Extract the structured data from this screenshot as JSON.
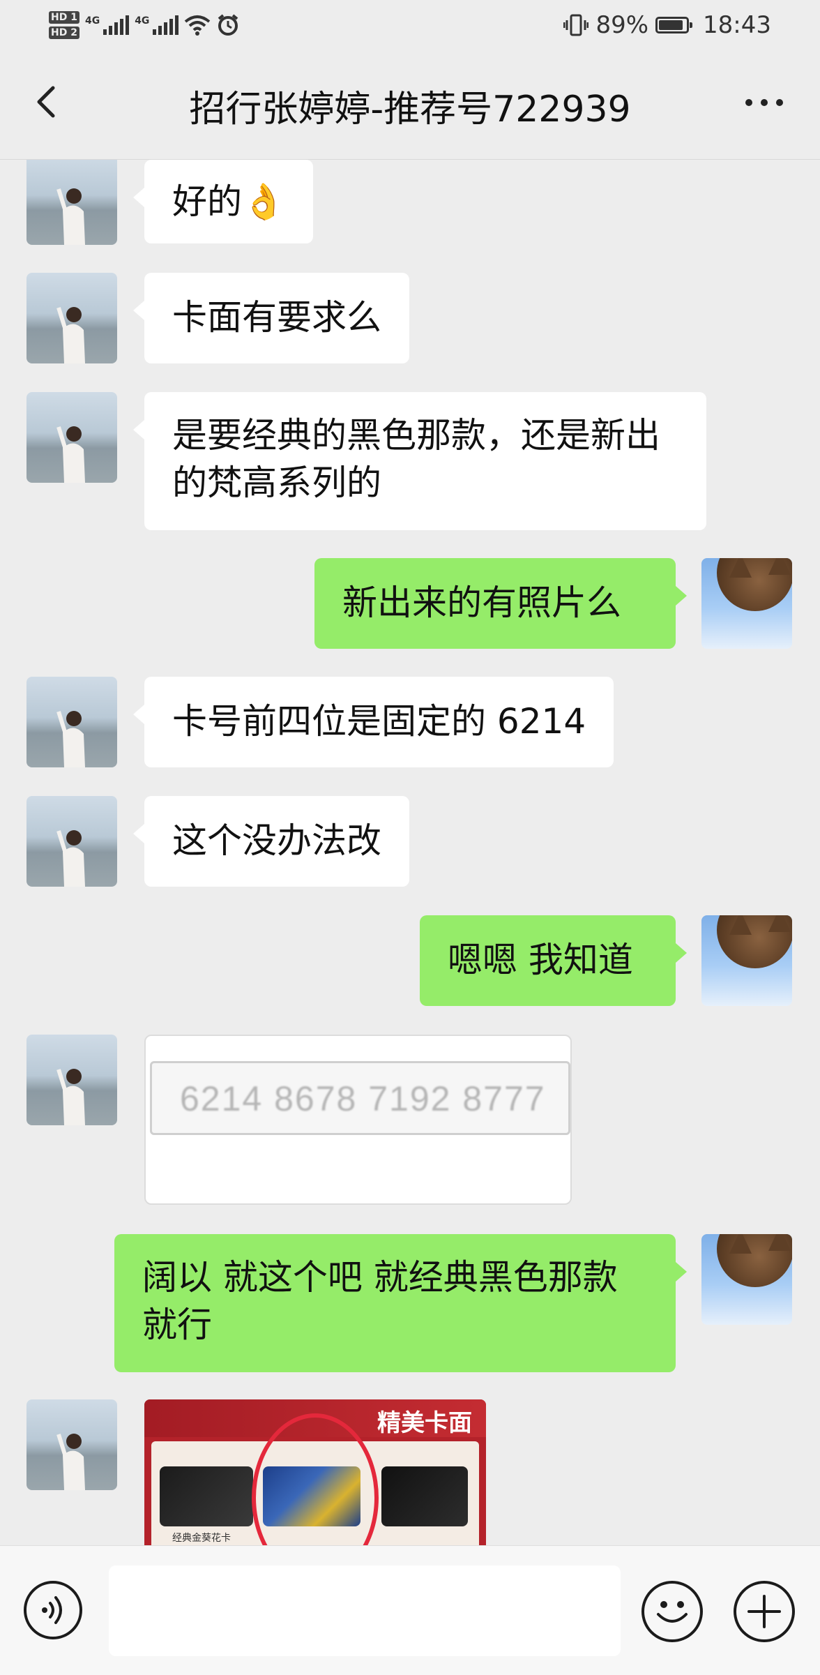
{
  "status_bar": {
    "hd1": "HD 1",
    "hd2": "HD 2",
    "net1": "4G",
    "net2": "4G",
    "battery": "89%",
    "battery_level": 0.89,
    "time": "18:43",
    "icons": [
      "signal-icon",
      "wifi-icon",
      "alarm-icon",
      "vibrate-icon",
      "battery-icon"
    ]
  },
  "header": {
    "title": "招行张婷婷-推荐号722939",
    "back_icon": "back-chevron-icon",
    "more_icon": "more-dots-icon"
  },
  "messages": [
    {
      "side": "left",
      "type": "text",
      "text": "好的👌"
    },
    {
      "side": "left",
      "type": "text",
      "text": "卡面有要求么"
    },
    {
      "side": "left",
      "type": "text",
      "text": "是要经典的黑色那款，还是新出的梵高系列的"
    },
    {
      "side": "right",
      "type": "text",
      "text": "新出来的有照片么"
    },
    {
      "side": "left",
      "type": "text",
      "text": "卡号前四位是固定的 6214"
    },
    {
      "side": "left",
      "type": "text",
      "text": "这个没办法改"
    },
    {
      "side": "right",
      "type": "text",
      "text": "嗯嗯 我知道"
    },
    {
      "side": "left",
      "type": "image",
      "card_number": "6214 8678 7192 8777"
    },
    {
      "side": "right",
      "type": "text",
      "text": "阔以 就这个吧  就经典黑色那款就行"
    },
    {
      "side": "left",
      "type": "image",
      "promo_title": "精美卡面",
      "caption": "经典金葵花卡"
    }
  ],
  "input_bar": {
    "voice_icon": "voice-icon",
    "emoji_icon": "emoji-icon",
    "plus_icon": "plus-icon",
    "text_value": ""
  },
  "colors": {
    "background": "#ededed",
    "bubble_mine": "#95ec69",
    "bubble_theirs": "#ffffff",
    "promo_red": "#b4222a"
  }
}
